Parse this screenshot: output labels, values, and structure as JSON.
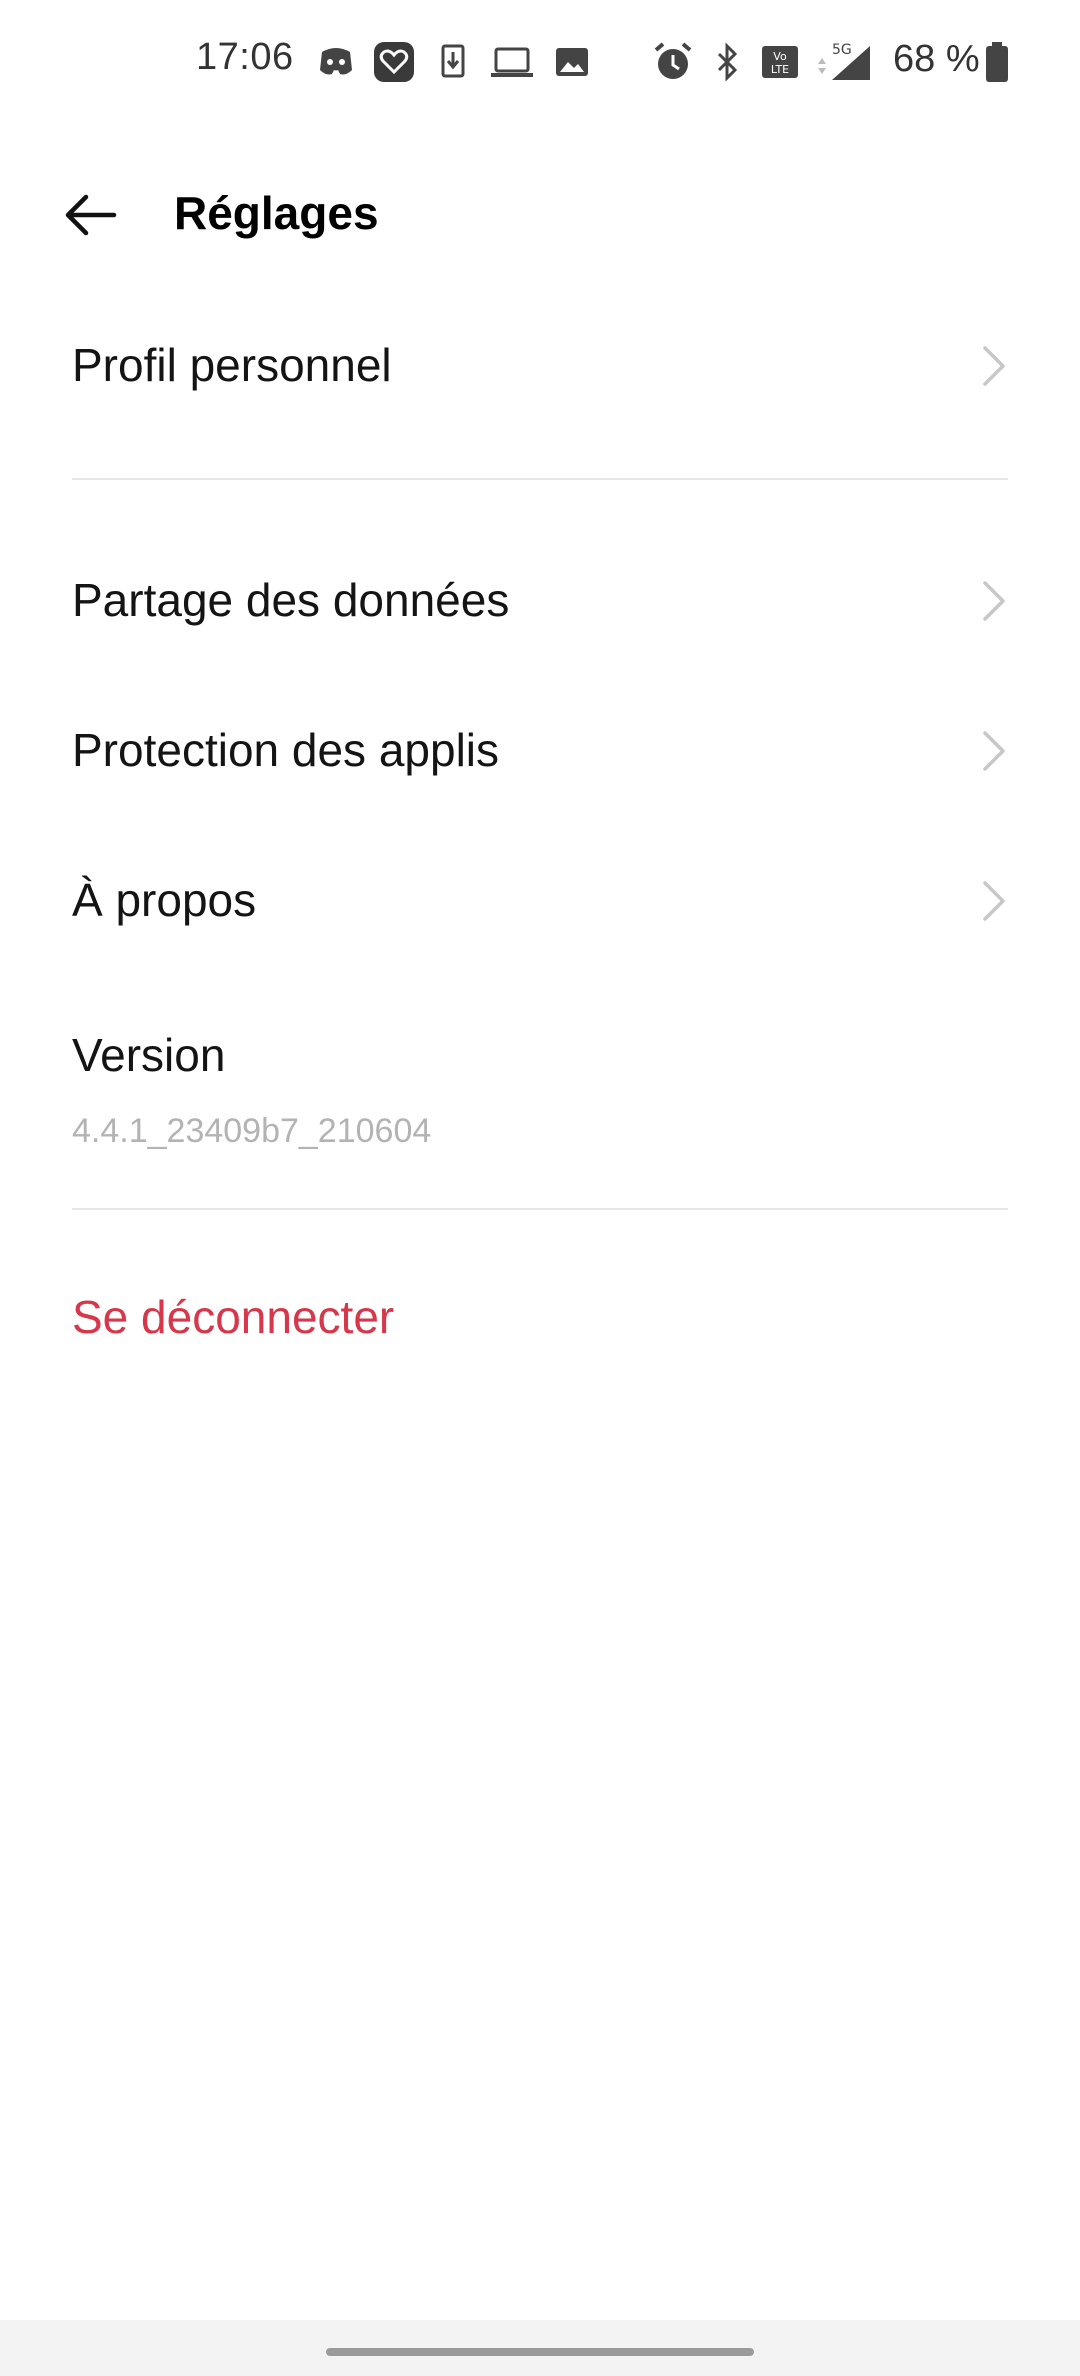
{
  "status_bar": {
    "time": "17:06",
    "battery_percent": "68 %",
    "network": "5G",
    "left_icons": [
      "discord-icon",
      "heart-app-icon",
      "download-icon",
      "laptop-icon",
      "image-icon"
    ],
    "right_icons": [
      "alarm-icon",
      "bluetooth-icon",
      "volte-icon",
      "signal-icon",
      "battery-icon"
    ]
  },
  "header": {
    "title": "Réglages",
    "back_icon": "arrow-left-icon"
  },
  "menu": {
    "profile": {
      "label": "Profil personnel"
    },
    "data_sharing": {
      "label": "Partage des données"
    },
    "app_protection": {
      "label": "Protection des applis"
    },
    "about": {
      "label": "À propos"
    },
    "version": {
      "label": "Version",
      "value": "4.4.1_23409b7_210604"
    },
    "logout": {
      "label": "Se déconnecter"
    }
  },
  "colors": {
    "accent_logout": "#d6374a",
    "secondary_text": "#b3b3b3",
    "chevron": "#c7c7c7",
    "divider": "#e6e6e6"
  }
}
